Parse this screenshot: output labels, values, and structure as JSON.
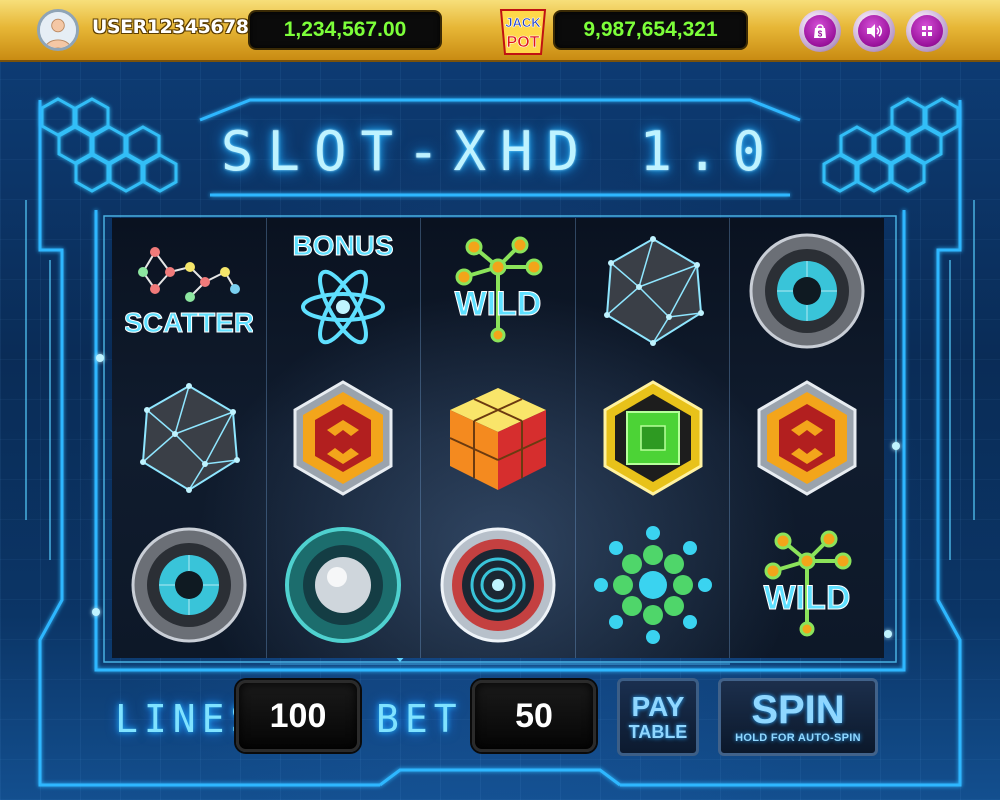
{
  "header": {
    "username": "USER12345678",
    "balance": "1,234,567.00",
    "jackpot_logo": {
      "line1": "JACK",
      "line2": "POT"
    },
    "jackpot_value": "9,987,654,321",
    "buttons": [
      {
        "name": "shop-icon"
      },
      {
        "name": "sound-icon"
      },
      {
        "name": "menu-icon"
      }
    ]
  },
  "game": {
    "title": "SLOT-XHD 1.0"
  },
  "reels": [
    [
      {
        "symbol": "scatter",
        "label": "SCATTER"
      },
      {
        "symbol": "polyhedron"
      },
      {
        "symbol": "iris-orb"
      }
    ],
    [
      {
        "symbol": "bonus-atom",
        "label": "BONUS"
      },
      {
        "symbol": "hex-emblem"
      },
      {
        "symbol": "teal-orb"
      }
    ],
    [
      {
        "symbol": "wild",
        "label": "WILD"
      },
      {
        "symbol": "cube"
      },
      {
        "symbol": "reactor-orb"
      }
    ],
    [
      {
        "symbol": "polyhedron"
      },
      {
        "symbol": "green-chip"
      },
      {
        "symbol": "dot-flower"
      }
    ],
    [
      {
        "symbol": "iris-orb"
      },
      {
        "symbol": "hex-emblem"
      },
      {
        "symbol": "wild",
        "label": "WILD"
      }
    ]
  ],
  "controls": {
    "lines_label": "LINES",
    "lines_value": "100",
    "bet_label": "BET",
    "bet_value": "50",
    "paytable_line1": "PAY",
    "paytable_line2": "TABLE",
    "spin_label": "SPIN",
    "spin_sub": "HOLD FOR AUTO-SPIN"
  }
}
